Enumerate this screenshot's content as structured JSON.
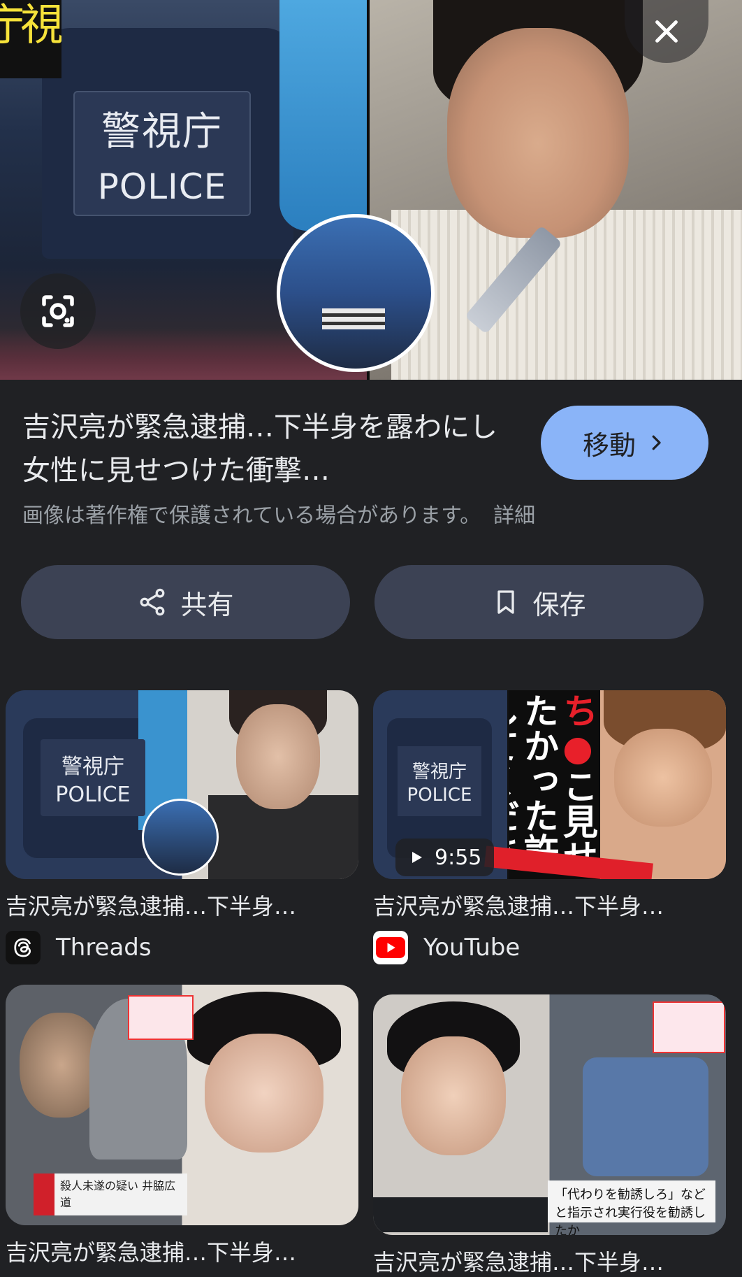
{
  "hero": {
    "left_vertical_text": "視庁",
    "patch_kanji": "警視庁",
    "patch_police": "POLICE"
  },
  "icons": {
    "close": "close-icon",
    "lens": "google-lens-icon",
    "share": "share-icon",
    "save": "bookmark-icon",
    "goto": "chevron-right-icon"
  },
  "info": {
    "title": "吉沢亮が緊急逮捕…下半身を露わにし女性に見せつけた衝撃…",
    "goto_label": "移動",
    "copyright": "画像は著作権で保護されている場合があります。",
    "details_link": "詳細",
    "share_label": "共有",
    "save_label": "保存"
  },
  "results": [
    {
      "title": "吉沢亮が緊急逮捕…下半身…",
      "source": "Threads",
      "thumb_text_1": "警視庁",
      "thumb_text_2": "POLICE"
    },
    {
      "title": "吉沢亮が緊急逮捕…下半身…",
      "source": "YouTube",
      "duration": "9:55",
      "thumb_text_1": "警視庁",
      "thumb_text_2": "POLICE",
      "thumb_vertical_a": "ち",
      "thumb_vertical_b": "●",
      "thumb_vertical_c": "こ見せたかった許してください"
    },
    {
      "title": "吉沢亮が緊急逮捕…下半身…",
      "caption": "殺人未遂の疑い 井脇広道"
    },
    {
      "title": "吉沢亮が緊急逮捕…下半身…",
      "caption": "「代わりを勧誘しろ」などと指示され実行役を勧誘したか"
    }
  ],
  "colors": {
    "background": "#202124",
    "goto_button": "#8ab4f8",
    "action_button": "#3c4254",
    "youtube_red": "#ff0000"
  }
}
